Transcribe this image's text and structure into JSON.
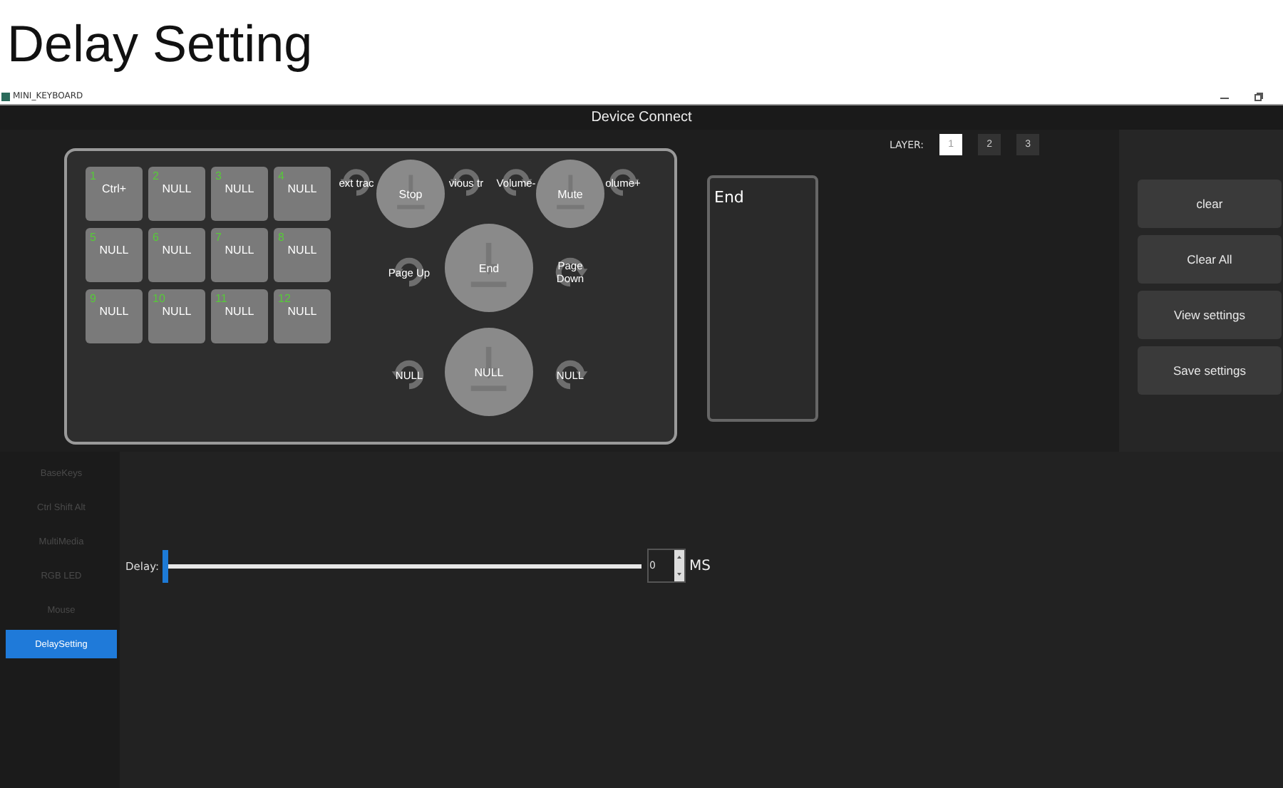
{
  "page_title": "Delay Setting",
  "window": {
    "title": "MINI_KEYBOARD",
    "header": "Device Connect"
  },
  "keys": [
    {
      "number": "1",
      "label": "Ctrl+"
    },
    {
      "number": "2",
      "label": "NULL"
    },
    {
      "number": "3",
      "label": "NULL"
    },
    {
      "number": "4",
      "label": "NULL"
    },
    {
      "number": "5",
      "label": "NULL"
    },
    {
      "number": "6",
      "label": "NULL"
    },
    {
      "number": "7",
      "label": "NULL"
    },
    {
      "number": "8",
      "label": "NULL"
    },
    {
      "number": "9",
      "label": "NULL"
    },
    {
      "number": "10",
      "label": "NULL"
    },
    {
      "number": "11",
      "label": "NULL"
    },
    {
      "number": "12",
      "label": "NULL"
    }
  ],
  "knobs": [
    {
      "kind": "ring",
      "label": "ext trac"
    },
    {
      "kind": "knob",
      "label": "Stop"
    },
    {
      "kind": "ring",
      "label": "vious tr"
    },
    {
      "kind": "ring",
      "label": "Volume-"
    },
    {
      "kind": "knob",
      "label": "Mute"
    },
    {
      "kind": "ring",
      "label": "olume+"
    },
    {
      "kind": "ring",
      "label": "Page Up"
    },
    {
      "kind": "knob",
      "label": "End"
    },
    {
      "kind": "ring",
      "label": "Page Down"
    },
    {
      "kind": "ring",
      "label": "NULL"
    },
    {
      "kind": "knob",
      "label": "NULL"
    },
    {
      "kind": "ring",
      "label": "NULL"
    }
  ],
  "display_text": "End",
  "layer": {
    "label": "LAYER:",
    "buttons": [
      {
        "label": "1",
        "selected": true
      },
      {
        "label": "2",
        "selected": false
      },
      {
        "label": "3",
        "selected": false
      }
    ]
  },
  "actions": [
    "clear",
    "Clear All",
    "View settings",
    "Save settings"
  ],
  "sidebar": {
    "items": [
      {
        "label": "BaseKeys",
        "selected": false
      },
      {
        "label": "Ctrl Shift Alt",
        "selected": false
      },
      {
        "label": "MultiMedia",
        "selected": false
      },
      {
        "label": "RGB LED",
        "selected": false
      },
      {
        "label": "Mouse",
        "selected": false
      },
      {
        "label": "DelaySetting",
        "selected": true
      }
    ]
  },
  "delay": {
    "label": "Delay:",
    "level": 0,
    "value": "0",
    "unit": "MS"
  }
}
